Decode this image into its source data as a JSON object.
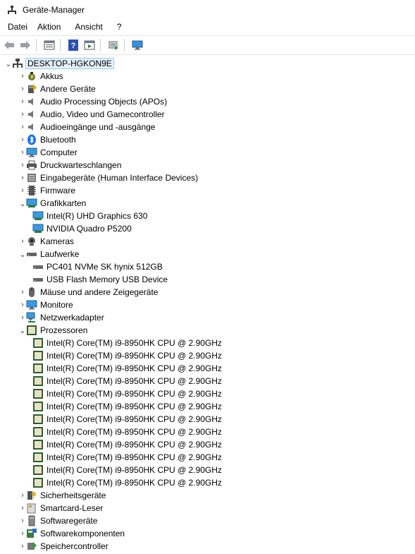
{
  "window": {
    "title": "Geräte-Manager"
  },
  "menu": [
    "Datei",
    "Aktion",
    "Ansicht",
    "?"
  ],
  "toolbar": {
    "buttons": [
      "back-icon",
      "forward-icon",
      "properties-icon",
      "help-icon",
      "view-icon",
      "update-driver-icon",
      "monitor-icon"
    ]
  },
  "tree": {
    "root": "DESKTOP-HGKON9E",
    "categories": [
      {
        "label": "Akkus",
        "expanded": false,
        "icon": "battery-icon"
      },
      {
        "label": "Andere Geräte",
        "expanded": false,
        "icon": "unknown-device-icon"
      },
      {
        "label": "Audio Processing Objects (APOs)",
        "expanded": false,
        "icon": "speaker-icon"
      },
      {
        "label": "Audio, Video und Gamecontroller",
        "expanded": false,
        "icon": "speaker-icon"
      },
      {
        "label": "Audioeingänge und -ausgänge",
        "expanded": false,
        "icon": "speaker-icon"
      },
      {
        "label": "Bluetooth",
        "expanded": false,
        "icon": "bluetooth-icon"
      },
      {
        "label": "Computer",
        "expanded": false,
        "icon": "computer-icon"
      },
      {
        "label": "Druckwarteschlangen",
        "expanded": false,
        "icon": "printer-icon"
      },
      {
        "label": "Eingabegeräte (Human Interface Devices)",
        "expanded": false,
        "icon": "hid-icon"
      },
      {
        "label": "Firmware",
        "expanded": false,
        "icon": "firmware-icon"
      },
      {
        "label": "Grafikkarten",
        "expanded": true,
        "icon": "display-adapter-icon",
        "children": [
          "Intel(R) UHD Graphics 630",
          "NVIDIA Quadro P5200"
        ]
      },
      {
        "label": "Kameras",
        "expanded": false,
        "icon": "camera-icon"
      },
      {
        "label": "Laufwerke",
        "expanded": true,
        "icon": "disk-icon",
        "children": [
          "PC401 NVMe SK hynix 512GB",
          "USB Flash Memory USB Device"
        ]
      },
      {
        "label": "Mäuse und andere Zeigegeräte",
        "expanded": false,
        "icon": "mouse-icon"
      },
      {
        "label": "Monitore",
        "expanded": false,
        "icon": "monitor-icon"
      },
      {
        "label": "Netzwerkadapter",
        "expanded": false,
        "icon": "network-icon"
      },
      {
        "label": "Prozessoren",
        "expanded": true,
        "icon": "processor-icon",
        "children": [
          "Intel(R) Core(TM) i9-8950HK CPU @ 2.90GHz",
          "Intel(R) Core(TM) i9-8950HK CPU @ 2.90GHz",
          "Intel(R) Core(TM) i9-8950HK CPU @ 2.90GHz",
          "Intel(R) Core(TM) i9-8950HK CPU @ 2.90GHz",
          "Intel(R) Core(TM) i9-8950HK CPU @ 2.90GHz",
          "Intel(R) Core(TM) i9-8950HK CPU @ 2.90GHz",
          "Intel(R) Core(TM) i9-8950HK CPU @ 2.90GHz",
          "Intel(R) Core(TM) i9-8950HK CPU @ 2.90GHz",
          "Intel(R) Core(TM) i9-8950HK CPU @ 2.90GHz",
          "Intel(R) Core(TM) i9-8950HK CPU @ 2.90GHz",
          "Intel(R) Core(TM) i9-8950HK CPU @ 2.90GHz",
          "Intel(R) Core(TM) i9-8950HK CPU @ 2.90GHz"
        ]
      },
      {
        "label": "Sicherheitsgeräte",
        "expanded": false,
        "icon": "security-icon"
      },
      {
        "label": "Smartcard-Leser",
        "expanded": false,
        "icon": "smartcard-icon"
      },
      {
        "label": "Softwaregeräte",
        "expanded": false,
        "icon": "software-device-icon"
      },
      {
        "label": "Softwarekomponenten",
        "expanded": false,
        "icon": "software-component-icon"
      },
      {
        "label": "Speichercontroller",
        "expanded": false,
        "icon": "storage-controller-icon"
      }
    ]
  }
}
